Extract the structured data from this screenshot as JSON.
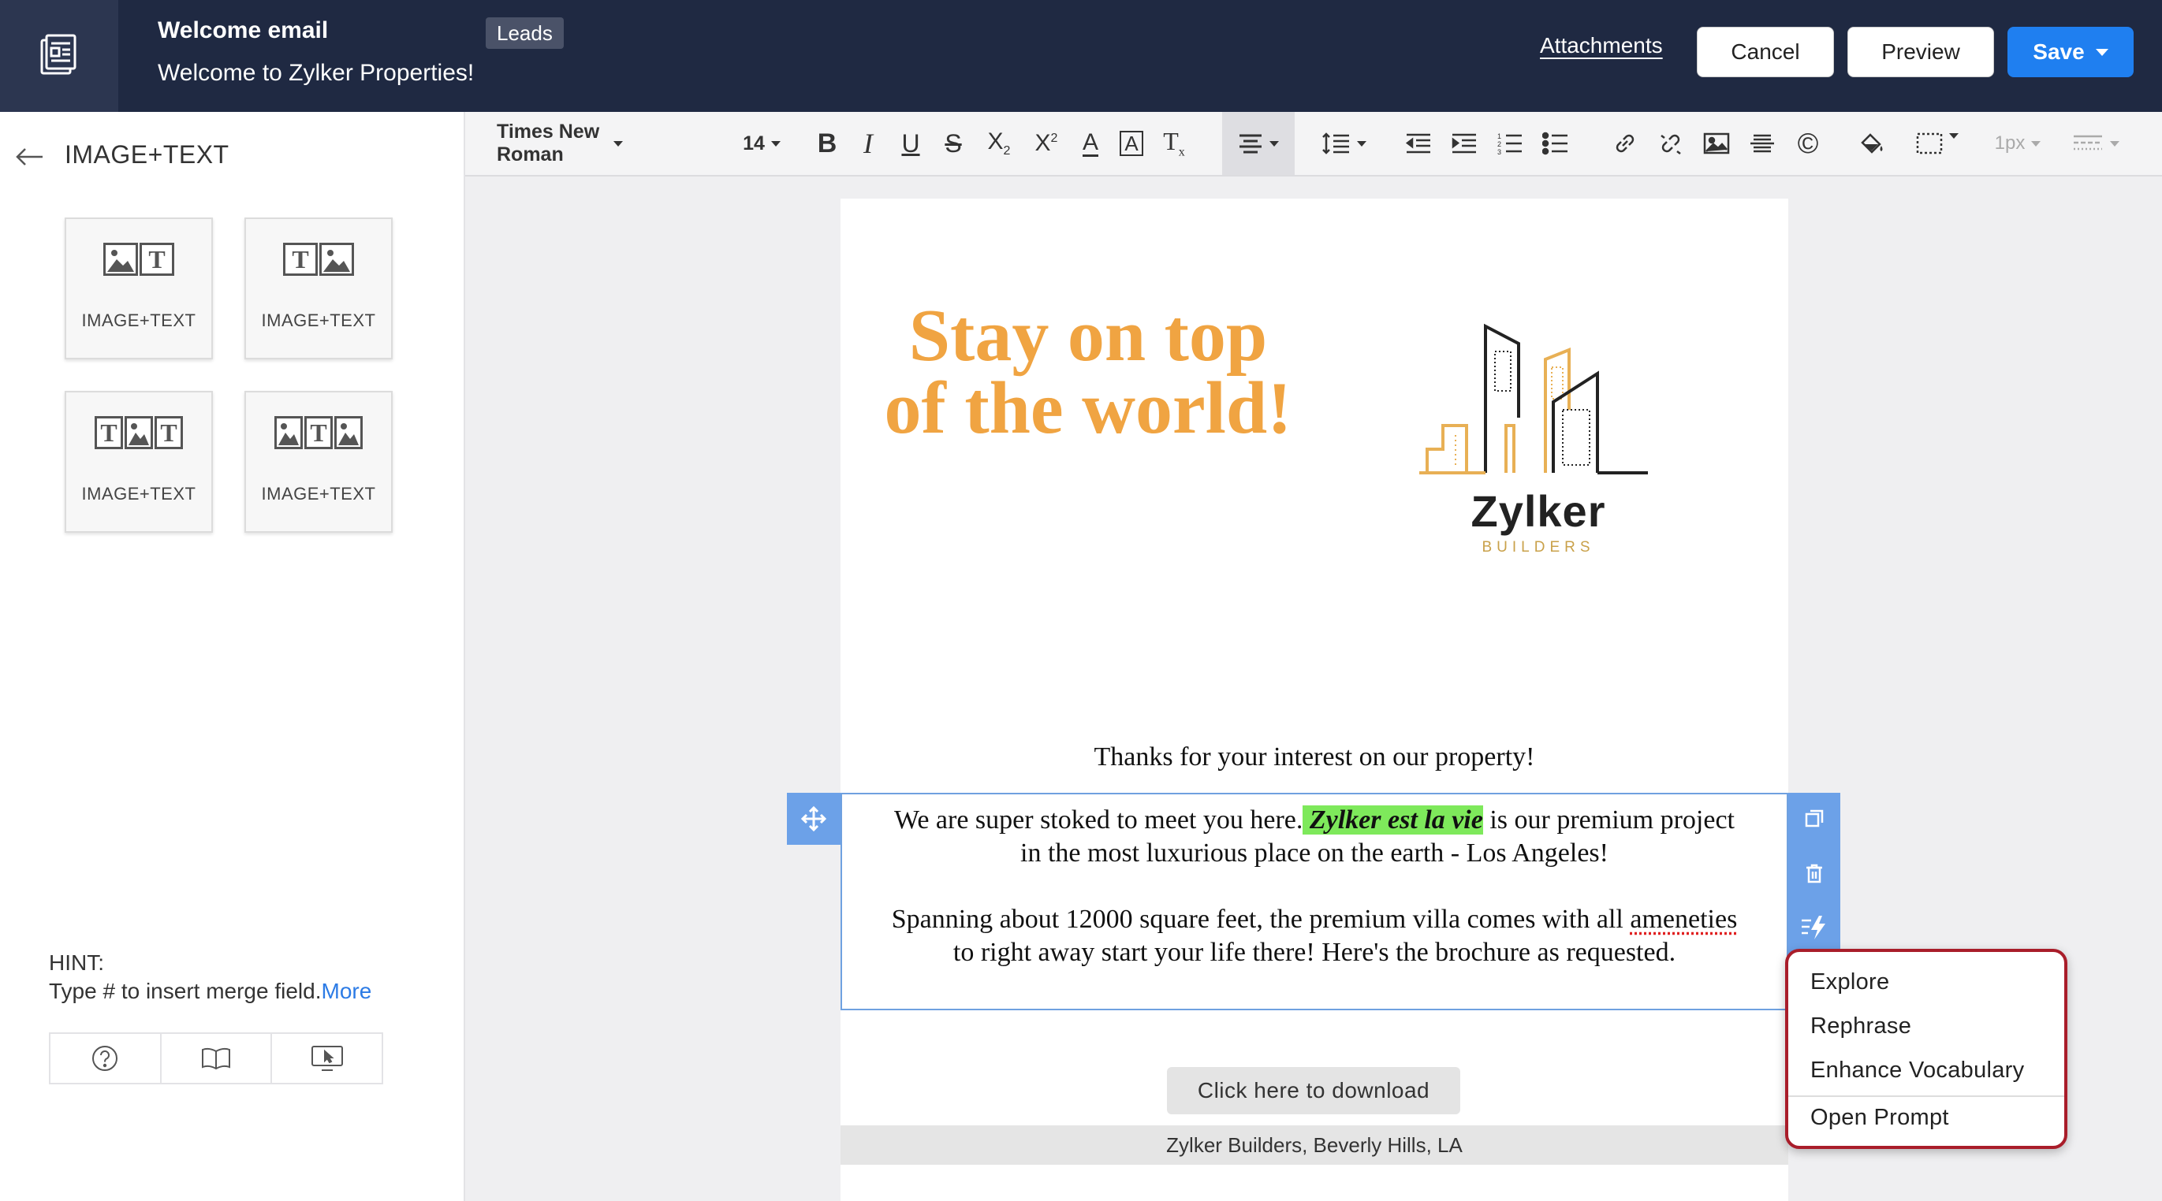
{
  "header": {
    "template_title": "Welcome email",
    "subject": "Welcome to Zylker Properties!",
    "module_badge": "Leads",
    "attachments_label": "Attachments",
    "cancel_label": "Cancel",
    "preview_label": "Preview",
    "save_label": "Save"
  },
  "left_panel": {
    "title": "IMAGE+TEXT",
    "blocks": [
      {
        "label": "IMAGE+TEXT",
        "layout": "image-text"
      },
      {
        "label": "IMAGE+TEXT",
        "layout": "text-image"
      },
      {
        "label": "IMAGE+TEXT",
        "layout": "text-image-text"
      },
      {
        "label": "IMAGE+TEXT",
        "layout": "image-text-image"
      }
    ],
    "hint_label": "HINT:",
    "hint_text": "Type # to insert merge field.",
    "hint_more": "More",
    "footer_icons": [
      "help-icon",
      "book-icon",
      "screen-pointer-icon"
    ]
  },
  "toolbar": {
    "font_family": "Times New Roman",
    "font_size": "14",
    "border_width": "1px",
    "buttons": [
      "bold",
      "italic",
      "underline",
      "strikethrough",
      "subscript",
      "superscript",
      "font-color",
      "background-color",
      "clear-format",
      "align",
      "line-height",
      "outdent",
      "indent",
      "ordered-list",
      "unordered-list",
      "link",
      "unlink",
      "image",
      "horizontal-line",
      "copyright",
      "fill-color",
      "border",
      "border-width",
      "border-style"
    ]
  },
  "email": {
    "hero_text": "Stay on top of the world!",
    "logo_name": "Zylker",
    "logo_sub": "BUILDERS",
    "thanks_line": "Thanks for your interest on our property!",
    "para1_before": "We are super stoked to meet you here.",
    "para1_highlight": " Zylker est la vie",
    "para1_after": " is our premium project in the most luxurious place on the earth - Los Angeles!",
    "para2_before": "Spanning about 12000 square feet, the premium villa comes with all ",
    "para2_misspelled": "ameneties",
    "para2_after": " to right away start your life there! Here's the brochure as requested.",
    "download_label": "Click here to download",
    "footer_text": "Zylker Builders, Beverly Hills, LA"
  },
  "ai_menu": {
    "items": [
      "Explore",
      "Rephrase",
      "Enhance Vocabulary"
    ],
    "prompt_item": "Open Prompt"
  },
  "colors": {
    "header_bg": "#1f2942",
    "save_blue": "#1f7ff0",
    "hero_orange": "#f0a442",
    "highlight_green": "#7ee95b",
    "selection_blue": "#6ca1e8",
    "menu_outline": "#a91d2a"
  }
}
